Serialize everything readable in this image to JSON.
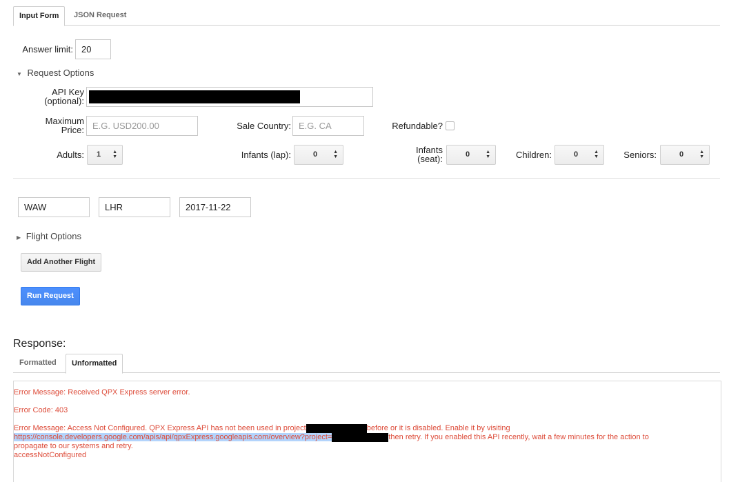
{
  "tabs": {
    "input_form": "Input Form",
    "json_request": "JSON Request"
  },
  "answer_limit": {
    "label": "Answer limit:",
    "value": "20"
  },
  "request_options": {
    "toggle": "Request Options",
    "api_key_label_1": "API Key",
    "api_key_label_2": "(optional):",
    "max_price_label_1": "Maximum",
    "max_price_label_2": "Price:",
    "max_price_placeholder": "E.G. USD200.00",
    "sale_country_label": "Sale Country:",
    "sale_country_placeholder": "E.G. CA",
    "refundable_label": "Refundable?",
    "adults_label": "Adults:",
    "adults_value": "1",
    "infants_lap_label": "Infants (lap):",
    "infants_lap_value": "0",
    "infants_seat_label_1": "Infants",
    "infants_seat_label_2": "(seat):",
    "infants_seat_value": "0",
    "children_label": "Children:",
    "children_value": "0",
    "seniors_label": "Seniors:",
    "seniors_value": "0"
  },
  "flight": {
    "origin": "WAW",
    "destination": "LHR",
    "date": "2017-11-22"
  },
  "flight_options": "Flight Options",
  "buttons": {
    "add_flight": "Add Another Flight",
    "run_request": "Run Request"
  },
  "response": {
    "heading": "Response:",
    "tab_formatted": "Formatted",
    "tab_unformatted": "Unformatted",
    "line1": "Error Message: Received QPX Express server error.",
    "line2": "Error Code: 403",
    "line3a": "Error Message: Access Not Configured. QPX Express API has not been used in project",
    "line3b": "before or it is disabled. Enable it by visiting",
    "link": "https://console.developers.google.com/apis/api/qpxExpress.googleapis.com/overview?project=",
    "line4b": "then retry. If you enabled this API recently, wait a few minutes for the action to",
    "line5": "propagate to our systems and retry.",
    "line6": "accessNotConfigured"
  },
  "colors": {
    "error_text": "#dd4b39",
    "primary_button": "#4d90fe",
    "link_highlight": "#b3d4fc"
  }
}
